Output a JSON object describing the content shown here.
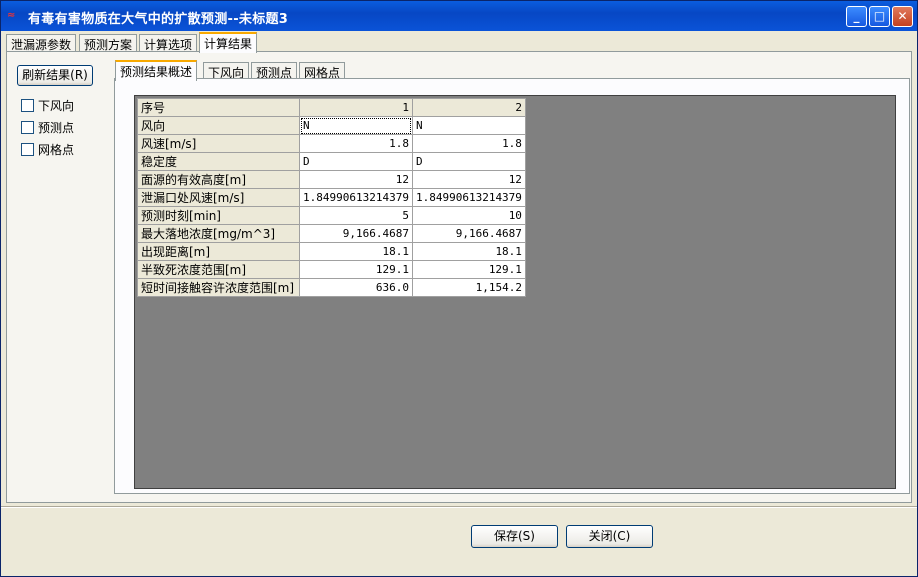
{
  "window": {
    "title": "有毒有害物质在大气中的扩散预测--未标题3",
    "minimize_label": "_",
    "maximize_label": "□",
    "close_label": "✕"
  },
  "top_tabs": [
    {
      "label": "泄漏源参数"
    },
    {
      "label": "预测方案"
    },
    {
      "label": "计算选项"
    },
    {
      "label": "计算结果"
    }
  ],
  "left_panel": {
    "refresh_label": "刷新结果(R)",
    "checks": [
      {
        "label": "下风向",
        "checked": false
      },
      {
        "label": "预测点",
        "checked": false
      },
      {
        "label": "网格点",
        "checked": false
      }
    ]
  },
  "inner_tabs": [
    {
      "label": "预测结果概述"
    },
    {
      "label": "下风向"
    },
    {
      "label": "预测点"
    },
    {
      "label": "网格点"
    }
  ],
  "table": {
    "header": {
      "label": "序号",
      "cols": [
        "1",
        "2"
      ]
    },
    "rows": [
      {
        "label": "风向",
        "v1": "N",
        "v2": "N"
      },
      {
        "label": "风速[m/s]",
        "v1": "1.8",
        "v2": "1.8"
      },
      {
        "label": "稳定度",
        "v1": "D",
        "v2": "D"
      },
      {
        "label": "面源的有效高度[m]",
        "v1": "12",
        "v2": "12"
      },
      {
        "label": "泄漏口处风速[m/s]",
        "v1": "1.84990613214379",
        "v2": "1.84990613214379"
      },
      {
        "label": "预测时刻[min]",
        "v1": "5",
        "v2": "10"
      },
      {
        "label": "最大落地浓度[mg/m^3]",
        "v1": "9,166.4687",
        "v2": "9,166.4687"
      },
      {
        "label": "出现距离[m]",
        "v1": "18.1",
        "v2": "18.1"
      },
      {
        "label": "半致死浓度范围[m]",
        "v1": "129.1",
        "v2": "129.1"
      },
      {
        "label": "短时间接触容许浓度范围[m]",
        "v1": "636.0",
        "v2": "1,154.2"
      }
    ]
  },
  "footer": {
    "save_label": "保存(S)",
    "close_label": "关闭(C)"
  }
}
